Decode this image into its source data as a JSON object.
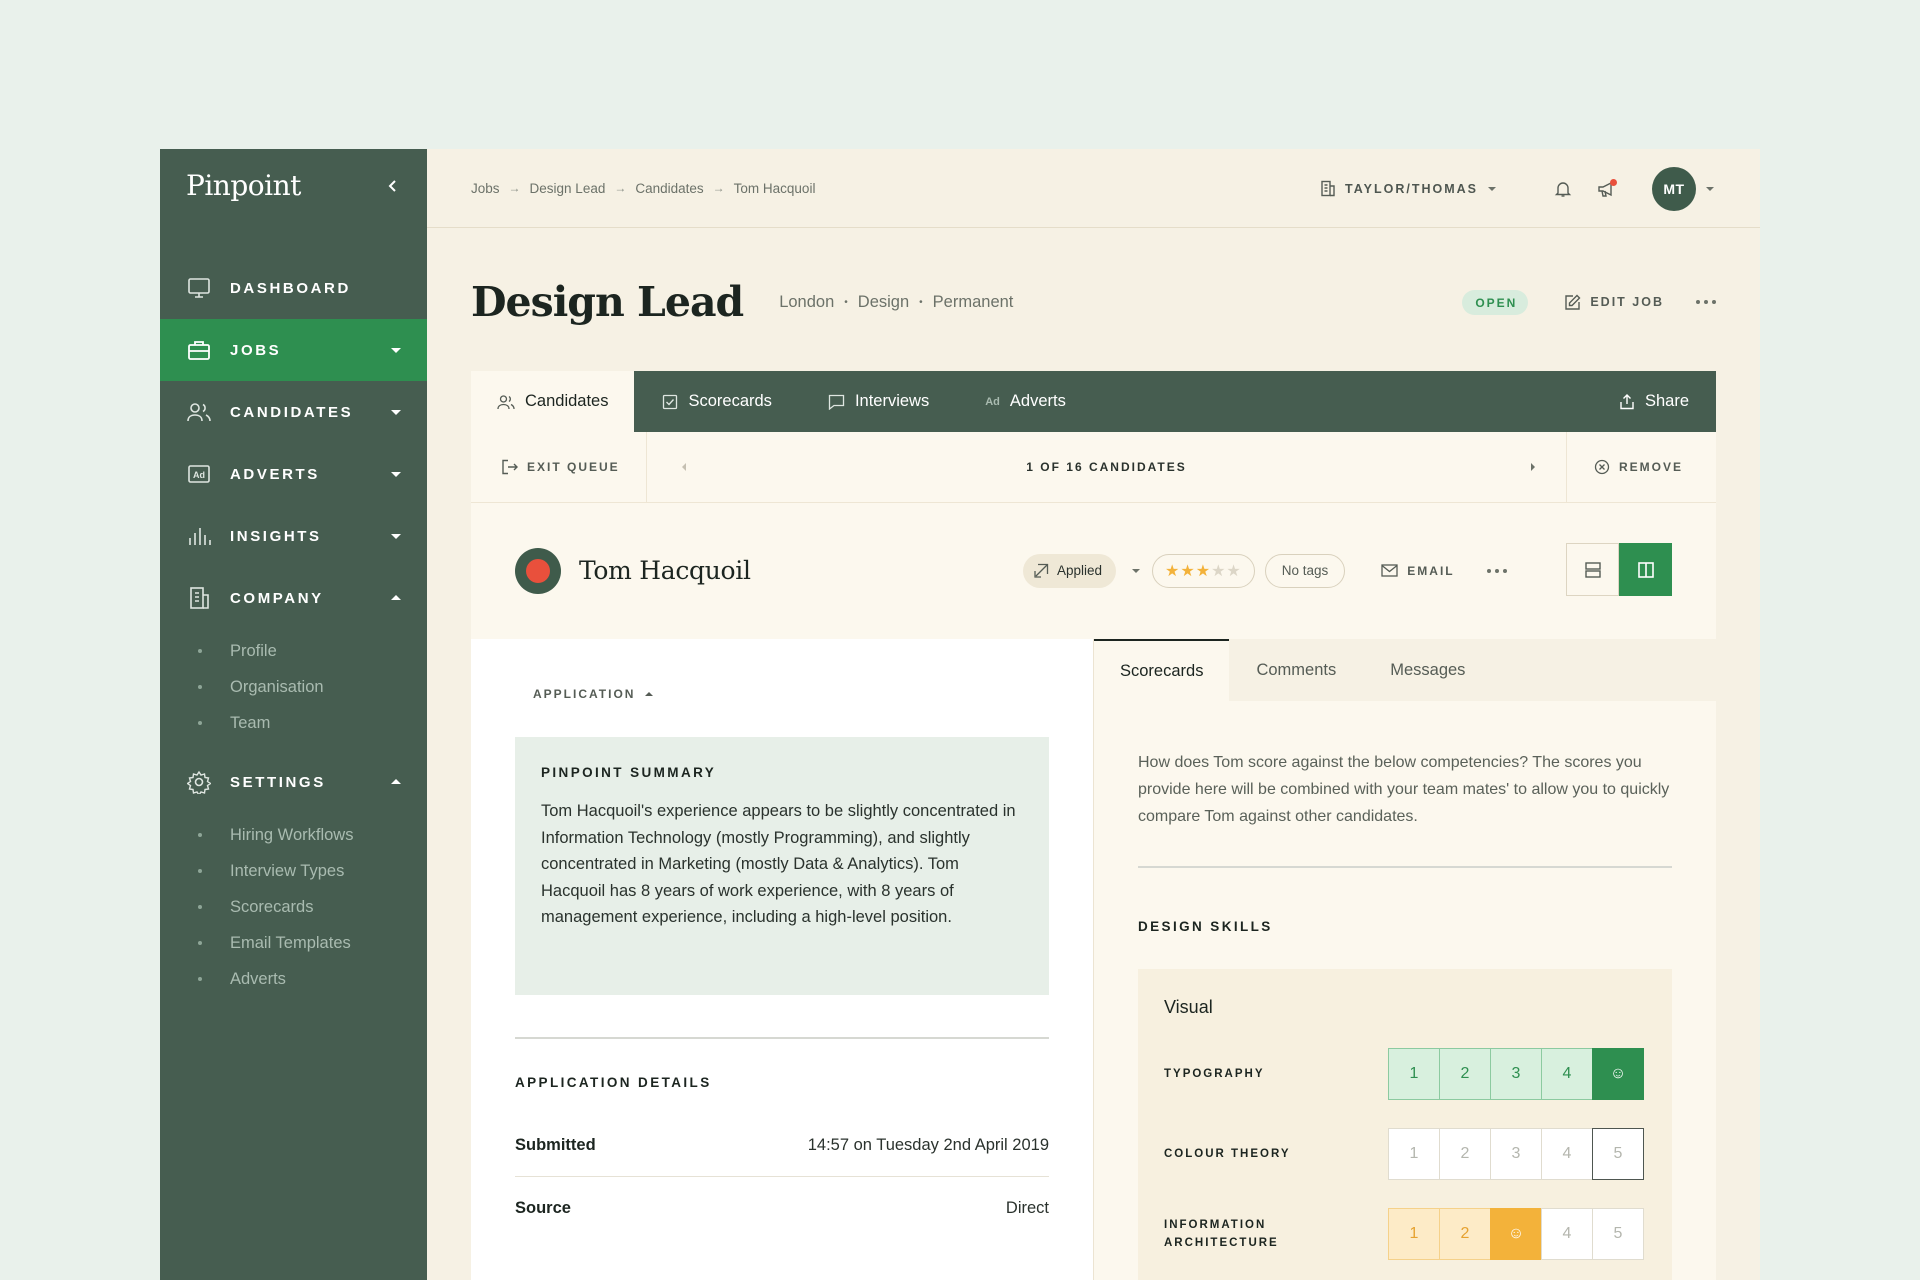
{
  "brand": "Pinpoint",
  "sidebar": {
    "nav": [
      {
        "label": "DASHBOARD",
        "icon": "monitor-icon"
      },
      {
        "label": "JOBS",
        "icon": "briefcase-icon"
      },
      {
        "label": "CANDIDATES",
        "icon": "users-icon"
      },
      {
        "label": "ADVERTS",
        "icon": "ad-icon"
      },
      {
        "label": "INSIGHTS",
        "icon": "bar-chart-icon"
      },
      {
        "label": "COMPANY",
        "icon": "building-icon"
      },
      {
        "label": "SETTINGS",
        "icon": "gear-icon"
      }
    ],
    "company_sub": [
      "Profile",
      "Organisation",
      "Team"
    ],
    "settings_sub": [
      "Hiring Workflows",
      "Interview Types",
      "Scorecards",
      "Email Templates",
      "Adverts"
    ]
  },
  "breadcrumb": [
    "Jobs",
    "Design Lead",
    "Candidates",
    "Tom Hacquoil"
  ],
  "breadcrumb_sep": "→",
  "topbar": {
    "org": "TAYLOR/THOMAS",
    "avatar": "MT"
  },
  "job": {
    "title": "Design Lead",
    "meta": [
      "London",
      "Design",
      "Permanent"
    ],
    "meta_sep": "•",
    "status": "OPEN",
    "edit_label": "EDIT JOB"
  },
  "tabs": [
    "Candidates",
    "Scorecards",
    "Interviews",
    "Adverts"
  ],
  "adverts_badge": "Ad",
  "share_label": "Share",
  "queue": {
    "exit": "EXIT QUEUE",
    "count": "1 OF 16 CANDIDATES",
    "remove": "REMOVE"
  },
  "candidate": {
    "name": "Tom Hacquoil",
    "stage": "Applied",
    "rating": 3,
    "rating_max": 5,
    "tags": "No tags",
    "email_label": "EMAIL"
  },
  "application": {
    "toggle_label": "APPLICATION",
    "summary_title": "PINPOINT SUMMARY",
    "summary_text": "Tom Hacquoil's experience appears to be slightly concentrated in Information Technology (mostly Programming), and slightly concentrated in Marketing (mostly Data & Analytics). Tom Hacquoil has 8 years of work experience, with 8 years of management experience, including a high-level position.",
    "details_title": "APPLICATION DETAILS",
    "details": [
      {
        "label": "Submitted",
        "value": "14:57 on Tuesday 2nd April 2019"
      },
      {
        "label": "Source",
        "value": "Direct"
      }
    ]
  },
  "right_tabs": [
    "Scorecards",
    "Comments",
    "Messages"
  ],
  "scorecard": {
    "intro": "How does Tom score against the below competencies? The scores you provide here will be combined with your team mates' to allow you to quickly compare Tom against other candidates.",
    "section": "DESIGN SKILLS",
    "group": "Visual",
    "skills": [
      {
        "label": "TYPOGRAPHY",
        "score": 5,
        "scale": [
          "1",
          "2",
          "3",
          "4",
          "☺"
        ]
      },
      {
        "label": "COLOUR THEORY",
        "score": null,
        "scale": [
          "1",
          "2",
          "3",
          "4",
          "5"
        ]
      },
      {
        "label": "INFORMATION ARCHITECTURE",
        "score": 3,
        "scale": [
          "1",
          "2",
          "☺",
          "4",
          "5"
        ]
      }
    ]
  },
  "colors": {
    "sidebar": "#465d50",
    "accent": "#2e8f50",
    "warning": "#f3b23a",
    "alert": "#e9503c"
  }
}
